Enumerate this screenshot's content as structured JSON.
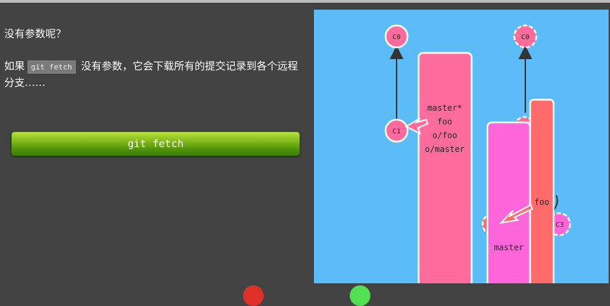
{
  "dialog": {
    "line1": "没有参数呢？",
    "line2_prefix": "如果",
    "line2_code": "git fetch",
    "line2_suffix": "没有参数，它会下载所有的提交记录到各个远程分支……"
  },
  "command_button": {
    "label": "git fetch"
  },
  "local_repo": {
    "commits": [
      "C0",
      "C1"
    ],
    "branch_labels": [
      "master*",
      "foo",
      "o/foo",
      "o/master"
    ]
  },
  "remote_repo": {
    "commits": [
      "C0",
      "C3"
    ],
    "branch_labels": {
      "master": "master",
      "foo": "foo"
    }
  },
  "colors": {
    "page_background": "#424242",
    "canvas_background": "#5cbcf8",
    "commit_node": "#ff6b9d",
    "master_branch_box": "#ff6b9d",
    "remote_master_box": "#ff66d9",
    "remote_foo_box": "#ff6b6b",
    "button_green": "#5aa10f"
  }
}
